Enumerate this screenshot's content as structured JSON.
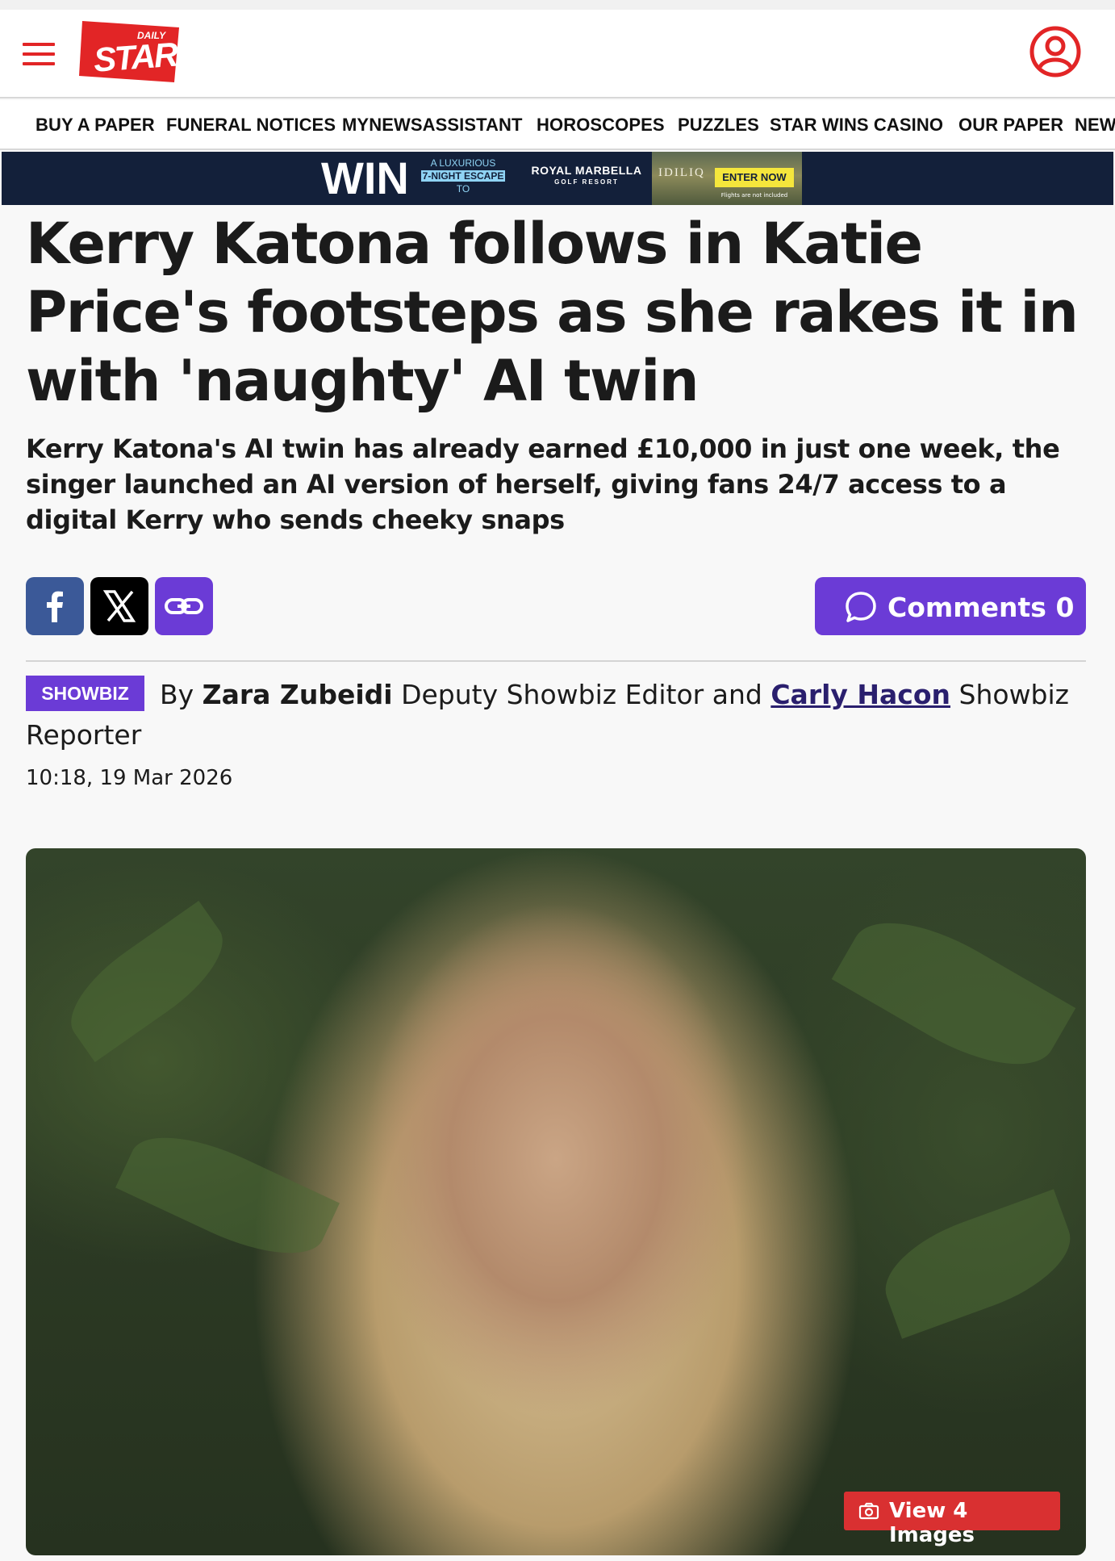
{
  "brand": {
    "logo_small": "DAILY",
    "logo_main": "STAR",
    "accent_color": "#e22526",
    "purple_color": "#6b3bd6"
  },
  "nav": {
    "items": [
      "BUY A PAPER",
      "FUNERAL NOTICES",
      "MYNEWSASSISTANT",
      "HOROSCOPES",
      "PUZZLES",
      "STAR WINS CASINO",
      "OUR PAPER",
      "NEW"
    ]
  },
  "ad": {
    "win": "WIN",
    "tag_line1": "A LUXURIOUS",
    "tag_line2": "7-NIGHT ESCAPE",
    "tag_line3": "TO",
    "brand": "ROYAL MARBELLA",
    "brand_sub": "GOLF RESORT",
    "partner": "IDILIQ",
    "cta": "ENTER NOW",
    "fine_print": "Flights are not included"
  },
  "article": {
    "headline": "Kerry Katona follows in Katie Price's footsteps as she rakes it in with 'naughty' AI twin",
    "standfirst": "Kerry Katona's AI twin has already earned £10,000 in just one week, the singer launched an AI version of herself, giving fans 24/7 access to a digital Kerry who sends cheeky snaps",
    "section": "SHOWBIZ",
    "by_prefix": "By",
    "author1": "Zara Zubeidi",
    "author1_role": "Deputy Showbiz Editor and",
    "author2": "Carly Hacon",
    "author2_role": "Showbiz Reporter",
    "timestamp": "10:18, 19 Mar 2026"
  },
  "share": {
    "facebook_icon": "facebook-icon",
    "x_icon": "x-icon",
    "link_icon": "link-icon",
    "comments_label": "Comments 0"
  },
  "hero": {
    "view_images": "View 4 Images",
    "camera_icon": "camera-icon"
  }
}
